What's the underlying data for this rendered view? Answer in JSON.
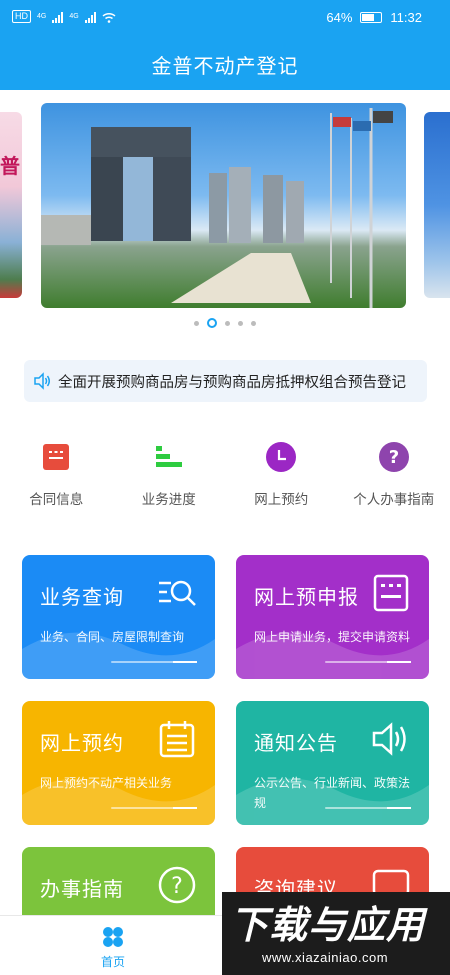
{
  "status_bar": {
    "network_badge": "HD",
    "signal_1": "4G",
    "signal_2": "4G",
    "battery": "64%",
    "time": "11:32"
  },
  "header": {
    "title": "金普不动产登记"
  },
  "carousel": {
    "slide_count": 5,
    "active_index": 1
  },
  "notice": {
    "icon": "speaker-icon",
    "text": "全面开展预购商品房与预购商品房抵押权组合预告登记"
  },
  "quick_links": [
    {
      "label": "合同信息",
      "icon": "document-icon",
      "color": "#e74c3c"
    },
    {
      "label": "业务进度",
      "icon": "progress-icon",
      "color": "#2ecc40"
    },
    {
      "label": "网上预约",
      "icon": "clock-icon",
      "color": "#9b27c4"
    },
    {
      "label": "个人办事指南",
      "icon": "help-icon",
      "color": "#8e44ad"
    }
  ],
  "cards": [
    {
      "title": "业务查询",
      "desc": "业务、合同、房屋限制查询",
      "icon": "search-list-icon",
      "color": "#1b8bf5"
    },
    {
      "title": "网上预申报",
      "desc": "网上申请业务，提交申请资料",
      "icon": "form-icon",
      "color": "#a32fc9"
    },
    {
      "title": "网上预约",
      "desc": "网上预约不动产相关业务",
      "icon": "calendar-icon",
      "color": "#f7b500"
    },
    {
      "title": "通知公告",
      "desc": "公示公告、行业新闻、政策法规",
      "icon": "speaker-icon",
      "color": "#1fb5a3"
    },
    {
      "title": "办事指南",
      "desc": "",
      "icon": "help-icon",
      "color": "#7cc43c"
    },
    {
      "title": "咨询建议",
      "desc": "",
      "icon": "chat-icon",
      "color": "#e74c3c"
    }
  ],
  "bottom_nav": {
    "home_label": "首页"
  },
  "watermark": {
    "title": "下载与应用",
    "url": "www.xiazainiao.com"
  }
}
